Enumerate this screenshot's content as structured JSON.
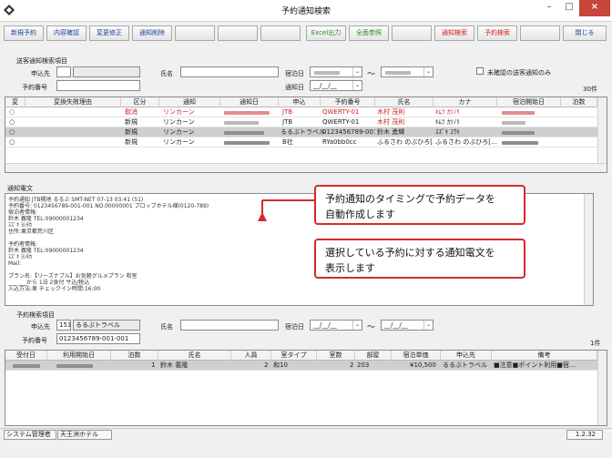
{
  "window": {
    "title": "予約通知検索"
  },
  "toolbar": {
    "left": [
      "新規予約",
      "内容確認",
      "変更修正",
      "通知削除"
    ],
    "mid": [
      "Excel出力",
      "全面参照"
    ],
    "right": [
      "通知検索",
      "予約検索"
    ],
    "close": "閉じる"
  },
  "mail_search": {
    "section_label": "送客通知検索項目",
    "customer_label": "申込先",
    "name_label": "氏名",
    "booking_no_label": "予約番号",
    "stay_date_label": "宿泊日",
    "notice_date_label": "通知日",
    "tilde": "～",
    "date_value": "__/__/__",
    "unconfirmed_label": "未確認の送客通知のみ",
    "count": "30件"
  },
  "notify_table": {
    "headers": [
      "変",
      "変換失敗理由",
      "区分",
      "通知",
      "通知日",
      "申込",
      "予約番号",
      "氏名",
      "カナ",
      "宿泊開始日",
      "泊数"
    ],
    "rows": [
      {
        "flag": "○",
        "type": "取消",
        "notice": "リンカーン",
        "company": "JTB",
        "booking": "QWERTY-01",
        "name": "木村 茂則",
        "kana": "ｷﾑﾗ ｶﾂﾉﾘ",
        "red": true
      },
      {
        "flag": "○",
        "type": "新規",
        "notice": "リンカーン",
        "company": "JTB",
        "booking": "QWERTY-01",
        "name": "木村 茂則",
        "kana": "ｷﾑﾗ ｶﾂﾉﾘ",
        "red": false
      },
      {
        "flag": "○",
        "type": "新規",
        "notice": "リンカーン",
        "company": "るるぶトラベル",
        "booking": "0123456789-001…",
        "name": "鈴木 勇輝",
        "kana": "ｽｽﾞｷ ﾕｳｷ",
        "red": false
      },
      {
        "flag": "○",
        "type": "新規",
        "notice": "リンカーン",
        "company": "B社",
        "booking": "RYa0bb0cc",
        "name": "ふるさわ のぶひろ[…",
        "kana": "ふるさわ のぶひろ[…",
        "red": false
      }
    ]
  },
  "mail_text": {
    "label": "通知電文",
    "lines": [
      "予約通知 JTB幌地 るるぶ               SMT-NET 07-13 03:41 (51)",
      "予約番号: 0123456789-001-001  NO.00000001 ブロッブホテル様(0120-789)",
      "宿泊者情報:",
      "  鈴木 義隆  TEL:09000001234",
      "  ｽｽﾞｷ ﾖｼﾀｶ",
      "  住所:東京都荒川区",
      "",
      "予約者情報:",
      "  鈴木 義隆  TEL:09000001234",
      "  ｽｽﾞｷ ﾖｼﾀｶ",
      "  Mail:",
      "",
      "プラン名:【リーズナブル】お気軽グルメプラン  和室",
      "  ___   ___から   1泊  2食付  サ込/税込",
      "入込方法:車              チェックイン時間:16:00"
    ]
  },
  "callouts": {
    "top": "予約通知のタイミングで予約データを\n自動作成します",
    "bottom": "選択している予約に対する通知電文を\n表示します"
  },
  "booking_search": {
    "section_label": "予約検索項目",
    "customer_label": "申込先",
    "customer_code": "151",
    "customer_name": "るるぶトラベル",
    "name_label": "氏名",
    "booking_no_label": "予約番号",
    "booking_no": "0123456789-001-001",
    "stay_date_label": "宿泊日",
    "date_value": "__/__/__",
    "tilde": "～",
    "count": "1件"
  },
  "booking_table": {
    "headers": [
      "受付日",
      "利用開始日",
      "泊数",
      "氏名",
      "人員",
      "室タイプ",
      "室数",
      "部屋",
      "宿泊単価",
      "申込先",
      "備考"
    ],
    "rows": [
      {
        "nights": "1",
        "name": "鈴木 義隆",
        "people": "2",
        "room_type": "和10",
        "rooms": "2",
        "room": "203",
        "price": "¥10,500",
        "company": "るるぶトラベル",
        "note": "■注意■ポイント利用■宿…"
      }
    ]
  },
  "status": {
    "user": "システム管理者",
    "hotel": "天王洲ホテル",
    "version": "1.2.32"
  }
}
